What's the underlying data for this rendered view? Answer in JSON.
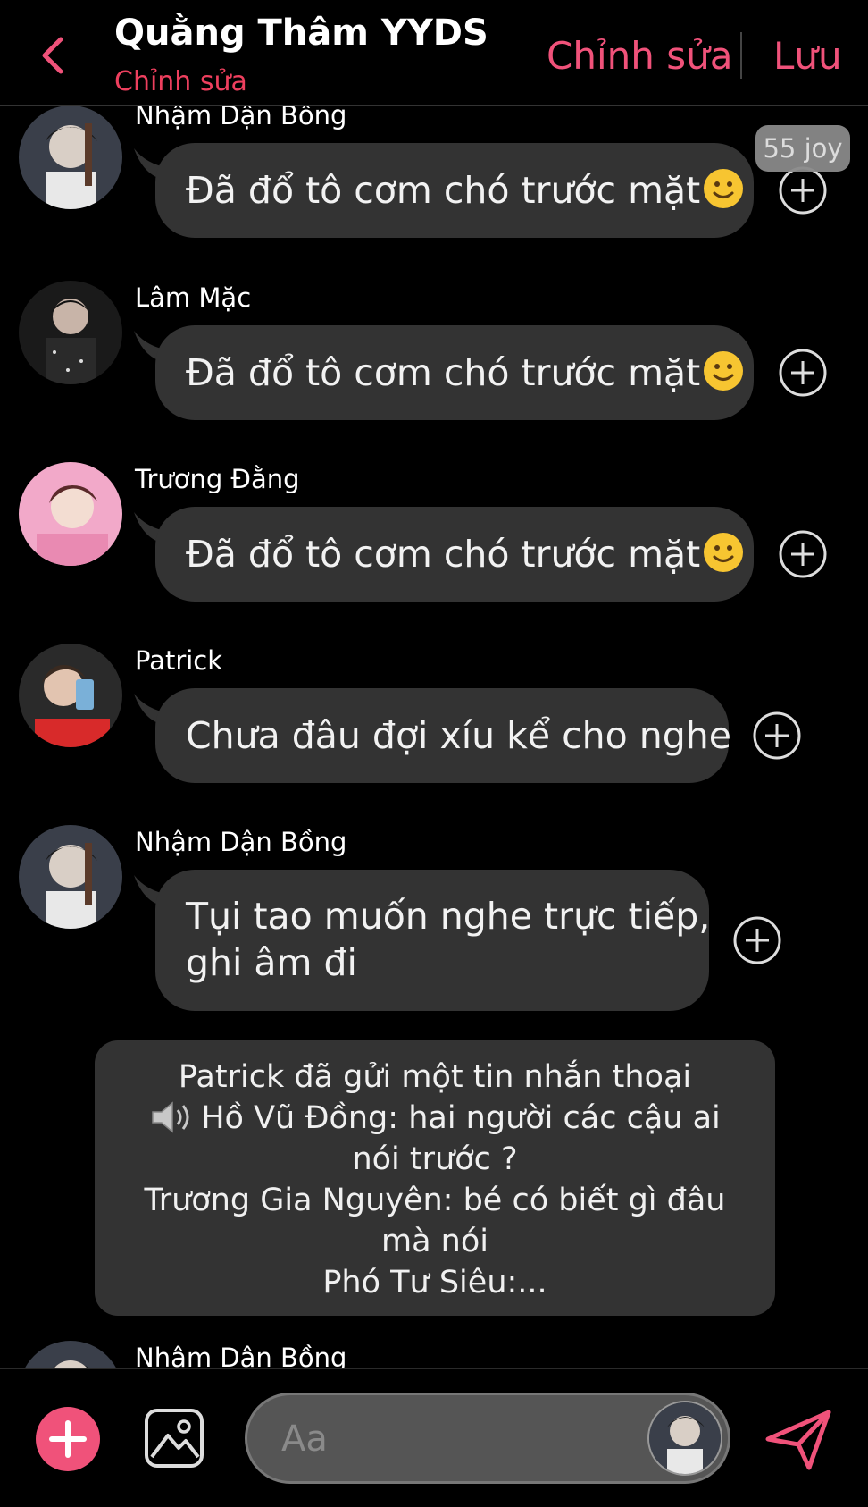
{
  "header": {
    "title": "Quằng Thâm YYDS",
    "subtitle": "Chỉnh sửa",
    "edit_label": "Chỉnh sửa",
    "save_label": "Lưu",
    "accent": "#f0527a"
  },
  "messages": [
    {
      "sender": "Nhậm Dận Bồng",
      "text": "Đã đổ tô cơm chó trước mặt",
      "emoji": "slightly-smiling-face",
      "reaction": "55 joy"
    },
    {
      "sender": "Lâm Mặc",
      "text": "Đã đổ tô cơm chó trước mặt",
      "emoji": "slightly-smiling-face"
    },
    {
      "sender": "Trương Đằng",
      "text": "Đã đổ tô cơm chó trước mặt",
      "emoji": "slightly-smiling-face"
    },
    {
      "sender": "Patrick",
      "text": "Chưa đâu đợi xíu kể cho nghe"
    },
    {
      "sender": "Nhậm Dận Bồng",
      "text_line1": "Tụi tao muốn nghe trực tiếp,",
      "text_line2": "ghi âm đi"
    }
  ],
  "system_message": {
    "line1": "Patrick đã gửi một tin nhắn thoại",
    "line2": "Hồ Vũ Đồng: hai người các cậu ai",
    "line3": "nói trước ?",
    "line4": "Trương Gia Nguyên: bé có biết gì đâu",
    "line5": "mà nói",
    "line6": "Phó Tư Siêu:..."
  },
  "partial_sender": "Nhậm Dận Bồng",
  "composer": {
    "placeholder": "Aa"
  }
}
